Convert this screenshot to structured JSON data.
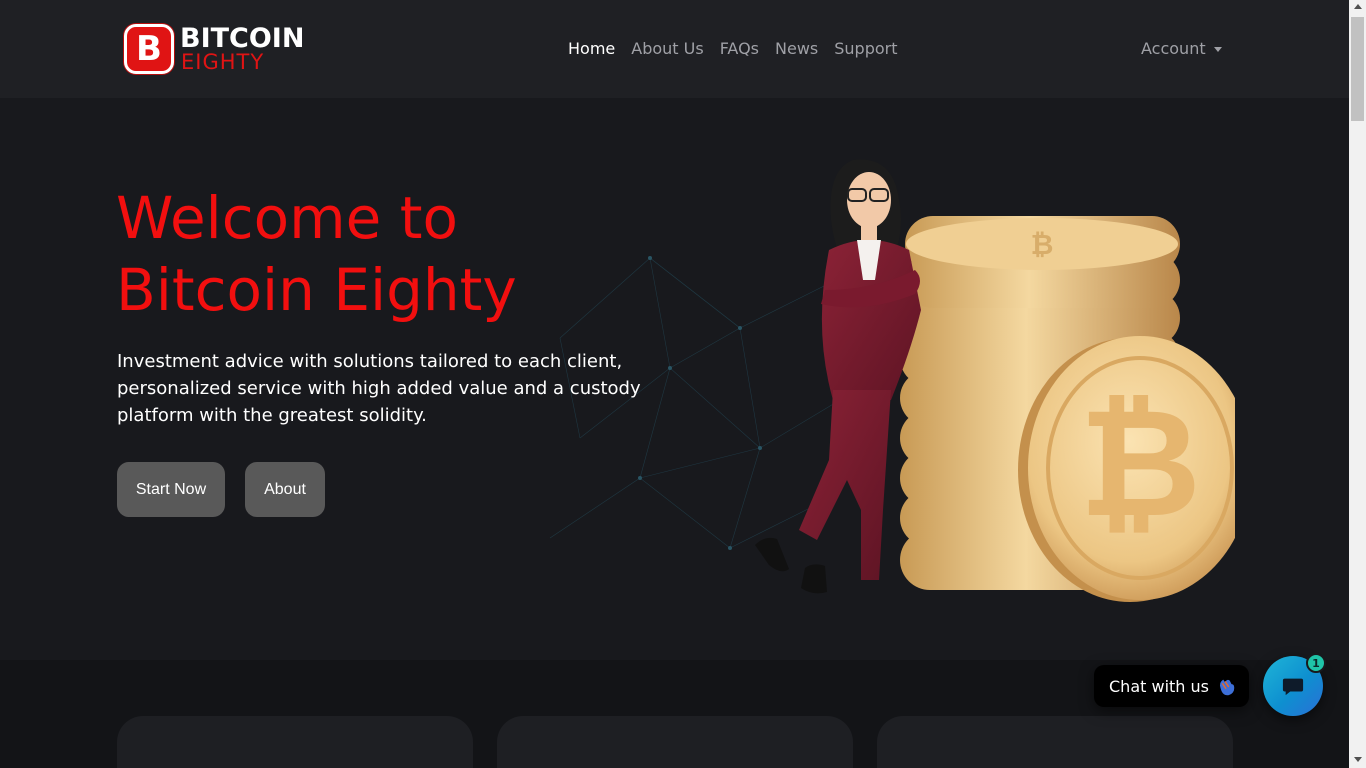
{
  "brand": {
    "word1": "BITCOIN",
    "word2": "EIGHTY",
    "badge_glyph": "B",
    "accent_color": "#e01414"
  },
  "nav": {
    "items": [
      {
        "label": "Home",
        "active": true
      },
      {
        "label": "About Us",
        "active": false
      },
      {
        "label": "FAQs",
        "active": false
      },
      {
        "label": "News",
        "active": false
      },
      {
        "label": "Support",
        "active": false
      }
    ],
    "account_label": "Account"
  },
  "hero": {
    "title_line1": "Welcome to",
    "title_line2": "Bitcoin Eighty",
    "subtitle": "Investment advice with solutions tailored to each client, personalized service with high added value and a custody platform with the greatest solidity.",
    "buttons": {
      "start_label": "Start Now",
      "about_label": "About"
    },
    "illustration_icon": "woman-leaning-on-coin-stack-illustration"
  },
  "chat": {
    "bubble_text": "Chat with us",
    "wave_icon": "waving-hand-icon",
    "launcher_icon": "chat-message-icon",
    "unread_count": "1"
  },
  "colors": {
    "title_red": "#f20f0f",
    "button_gray": "#595959",
    "background": "#18191d",
    "navbar": "#1f2024"
  }
}
